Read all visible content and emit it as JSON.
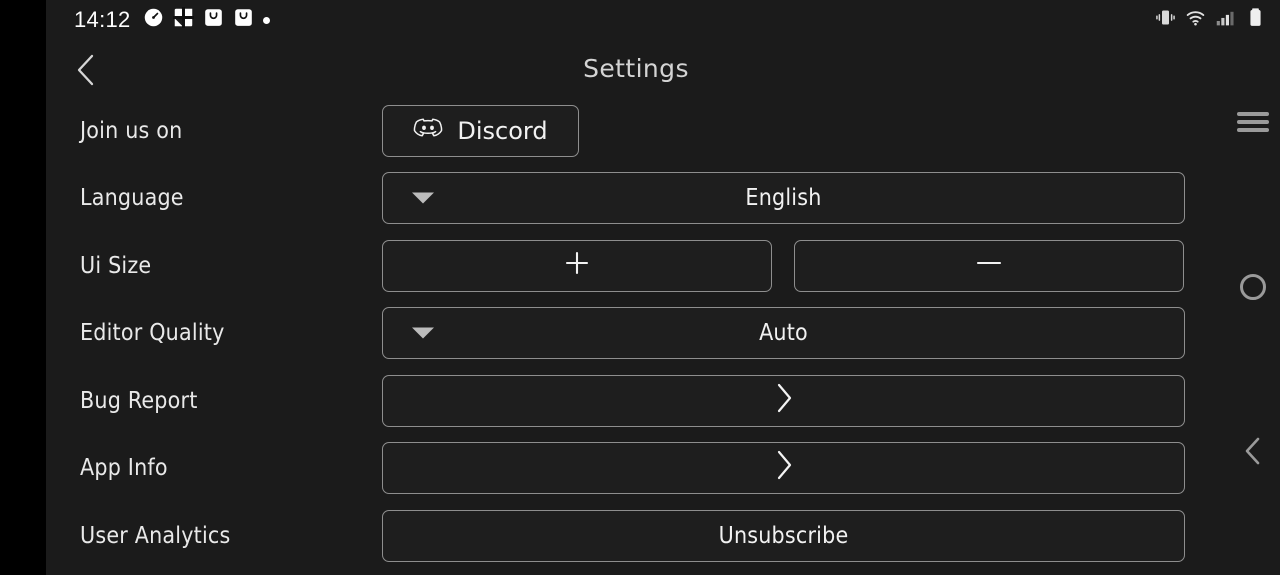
{
  "statusbar": {
    "time": "14:12",
    "left_icons": [
      {
        "name": "speedometer-icon"
      },
      {
        "name": "puzzle-piece-icon"
      },
      {
        "name": "shopping-bag-icon"
      },
      {
        "name": "shopping-bag-icon"
      },
      {
        "name": "dot-indicator-icon"
      }
    ],
    "right_icons": [
      {
        "name": "vibrate-icon"
      },
      {
        "name": "wifi-icon"
      },
      {
        "name": "cellular-signal-icon"
      },
      {
        "name": "battery-icon"
      }
    ]
  },
  "header": {
    "title": "Settings",
    "back_label": "Back"
  },
  "settings": {
    "rows": [
      {
        "label": "Join us on",
        "control": "discord-button",
        "value": "Discord"
      },
      {
        "label": "Language",
        "control": "dropdown",
        "value": "English"
      },
      {
        "label": "Ui Size",
        "control": "stepper",
        "increase": "+",
        "decrease": "—"
      },
      {
        "label": "Editor Quality",
        "control": "dropdown",
        "value": "Auto"
      },
      {
        "label": "Bug Report",
        "control": "navigate",
        "value": ""
      },
      {
        "label": "App Info",
        "control": "navigate",
        "value": ""
      },
      {
        "label": "User Analytics",
        "control": "action-button",
        "value": "Unsubscribe"
      }
    ]
  },
  "navbar": {
    "recents_label": "Recents",
    "home_label": "Home",
    "back_label": "Back"
  },
  "colors": {
    "background": "#1b1b1b",
    "bezel": "#000000",
    "border": "#8e8e8e",
    "text": "#e9e9e9",
    "title": "#d4d4d4",
    "nav": "#9a9a9a"
  }
}
